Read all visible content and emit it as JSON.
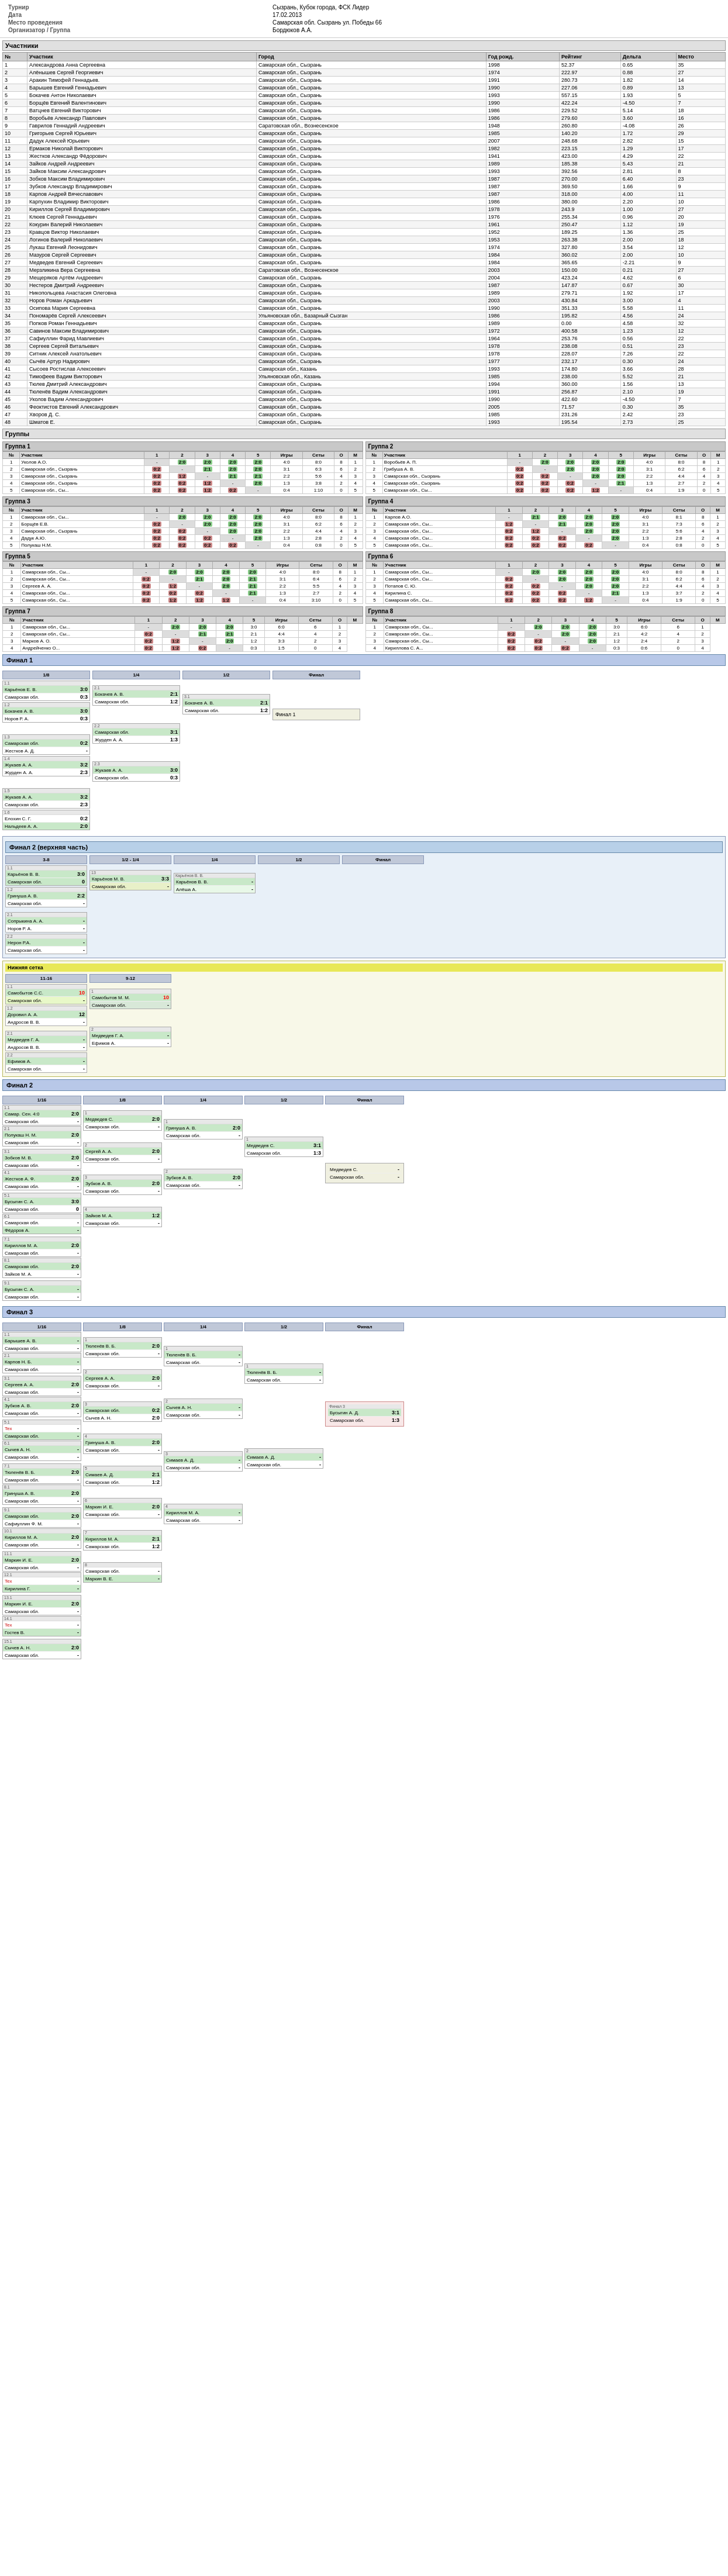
{
  "tournament": {
    "title": "Турнир",
    "city": "Сызрань, Кубок города, ФСК Лидер",
    "date": "17.02.2013",
    "venue": "Место проведения",
    "venue_val": "Самарская обл. Сызрань ул. Победы 66",
    "organizer_label": "Организатор / Группа",
    "organizer_val": "Бордюков А.А."
  },
  "participants_header": [
    "№",
    "Участник",
    "Город",
    "Год рожд.",
    "Рейтинг",
    "Дельта",
    "Место"
  ],
  "participants": [
    [
      "1",
      "Александрова Анна Сергеевна",
      "Самарская обл., Сызрань",
      "1998",
      "52.37",
      "0.65",
      "35"
    ],
    [
      "2",
      "Алёнышев Сергей Георгиевич",
      "Самарская обл., Сызрань",
      "1974",
      "222.97",
      "0.88",
      "27"
    ],
    [
      "3",
      "Аракин Тимофей Геннадьев.",
      "Самарская обл., Сызрань",
      "1991",
      "280.73",
      "1.82",
      "14"
    ],
    [
      "4",
      "Барышев Евгений Геннадьевич",
      "Самарская обл., Сызрань",
      "1990",
      "227.06",
      "0.89",
      "13"
    ],
    [
      "5",
      "Бокачев Антон Николаевич",
      "Самарская обл., Сызрань",
      "1993",
      "557.15",
      "1.93",
      "5"
    ],
    [
      "6",
      "Борщёв Евгений Валентинович",
      "Самарская обл., Сызрань",
      "1990",
      "422.24",
      "-4.50",
      "7"
    ],
    [
      "7",
      "Ватцнев Евгений Викторович",
      "Самарская обл., Сызрань",
      "1986",
      "229.52",
      "5.14",
      "18"
    ],
    [
      "8",
      "Воробьёв Александр Павлович",
      "Самарская обл., Сызрань",
      "1986",
      "279.60",
      "3.60",
      "16"
    ],
    [
      "9",
      "Гаврилов Геннадий Андреевич",
      "Саратовская обл., Вознесенское",
      "1948",
      "260.80",
      "-4.08",
      "26"
    ],
    [
      "10",
      "Григорьев Сергей Юрьевич",
      "Самарская обл., Сызрань",
      "1985",
      "140.20",
      "1.72",
      "29"
    ],
    [
      "11",
      "Дадук Алексей Юрьевич",
      "Самарская обл., Сызрань",
      "2007",
      "248.68",
      "2.82",
      "15"
    ],
    [
      "12",
      "Ермаков Николай Викторович",
      "Самарская обл., Сызрань",
      "1982",
      "223.15",
      "1.29",
      "17"
    ],
    [
      "13",
      "Жестков Александр Фёдорович",
      "Самарская обл., Сызрань",
      "1941",
      "423.00",
      "4.29",
      "22"
    ],
    [
      "14",
      "Зайков Андрей Андреевич",
      "Самарская обл., Сызрань",
      "1989",
      "185.38",
      "5.43",
      "21"
    ],
    [
      "15",
      "Зайков Максим Александрович",
      "Самарская обл., Сызрань",
      "1993",
      "392.56",
      "2.81",
      "8"
    ],
    [
      "16",
      "Зобков Максим Владимирович",
      "Самарская обл., Сызрань",
      "1987",
      "270.00",
      "6.40",
      "23"
    ],
    [
      "17",
      "Зубков Александр Владимирович",
      "Самарская обл., Сызрань",
      "1987",
      "369.50",
      "1.66",
      "9"
    ],
    [
      "18",
      "Карпов Андрей Вячеславович",
      "Самарская обл., Сызрань",
      "1987",
      "318.00",
      "4.00",
      "11"
    ],
    [
      "19",
      "Карпухин Владимир Викторович",
      "Самарская обл., Сызрань",
      "1986",
      "380.00",
      "2.20",
      "10"
    ],
    [
      "20",
      "Кириллов Сергей Владимирович",
      "Самарская обл., Сызрань",
      "1978",
      "243.9",
      "1.00",
      "27"
    ],
    [
      "21",
      "Клюев Сергей Геннадьевич",
      "Самарская обл., Сызрань",
      "1976",
      "255.34",
      "0.96",
      "20"
    ],
    [
      "22",
      "Кокурин Валерий Николаевич",
      "Самарская обл., Сызрань",
      "1961",
      "250.47",
      "1.12",
      "19"
    ],
    [
      "23",
      "Кравцов Виктор Николаевич",
      "Самарская обл., Сызрань",
      "1952",
      "189.25",
      "1.36",
      "25"
    ],
    [
      "24",
      "Логинов Валерий Николаевич",
      "Самарская обл., Сызрань",
      "1953",
      "263.38",
      "2.00",
      "18"
    ],
    [
      "25",
      "Лукаш Евгений Леонидович",
      "Самарская обл., Сызрань",
      "1974",
      "327.80",
      "3.54",
      "12"
    ],
    [
      "26",
      "Мазуров Сергей Сергеевич",
      "Самарская обл., Сызрань",
      "1984",
      "360.02",
      "2.00",
      "10"
    ],
    [
      "27",
      "Медведев Евгений Сергеевич",
      "Самарская обл., Сызрань",
      "1984",
      "365.65",
      "-2.21",
      "9"
    ],
    [
      "28",
      "Мерзликина Вера Сергеевна",
      "Саратовская обл., Вознесенское",
      "2003",
      "150.00",
      "0.21",
      "27"
    ],
    [
      "29",
      "Мещеряков Артём Андреевич",
      "Самарская обл., Сызрань",
      "2004",
      "423.24",
      "4.62",
      "6"
    ],
    [
      "30",
      "Нестеров Дмитрий Андреевич",
      "Самарская обл., Сызрань",
      "1987",
      "147.87",
      "0.67",
      "30"
    ],
    [
      "31",
      "Никопольцева Анастасия Олеговна",
      "Самарская обл., Сызрань",
      "1989",
      "279.71",
      "1.92",
      "17"
    ],
    [
      "32",
      "Норов Роман Аркадьевич",
      "Самарская обл., Сызрань",
      "2003",
      "430.84",
      "3.00",
      "4"
    ],
    [
      "33",
      "Осипова Мария Сергеевна",
      "Самарская обл., Сызрань",
      "1990",
      "351.33",
      "5.58",
      "11"
    ],
    [
      "34",
      "Пономарёв Сергей Алексеевич",
      "Ульяновская обл., Базарный Сызган",
      "1986",
      "195.82",
      "4.56",
      "24"
    ],
    [
      "35",
      "Попков Роман Геннадьевич",
      "Самарская обл., Сызрань",
      "1989",
      "0.00",
      "4.58",
      "32"
    ],
    [
      "36",
      "Савинов Максим Владимирович",
      "Самарская обл., Сызрань",
      "1972",
      "400.58",
      "1.23",
      "12"
    ],
    [
      "37",
      "Сафиуллин Фарид Мавлиевич",
      "Самарская обл., Сызрань",
      "1964",
      "253.76",
      "0.56",
      "22"
    ],
    [
      "38",
      "Сергеев Сергей Витальевич",
      "Самарская обл., Сызрань",
      "1978",
      "238.08",
      "0.51",
      "23"
    ],
    [
      "39",
      "Ситник Алексей Анатольевич",
      "Самарская обл., Сызрань",
      "1978",
      "228.07",
      "7.26",
      "22"
    ],
    [
      "40",
      "Сычёв Артур Надирович",
      "Самарская обл., Сызрань",
      "1977",
      "232.17",
      "0.30",
      "24"
    ],
    [
      "41",
      "Сысоев Ростислав Алексеевич",
      "Самарская обл., Казань",
      "1993",
      "174.80",
      "3.66",
      "28"
    ],
    [
      "42",
      "Тимофеев Вадим Викторович",
      "Ульяновская обл., Казань",
      "1985",
      "238.00",
      "5.52",
      "21"
    ],
    [
      "43",
      "Тюлев Дмитрий Александрович",
      "Самарская обл., Сызрань",
      "1994",
      "360.00",
      "1.56",
      "13"
    ],
    [
      "44",
      "Тюленёв Вадим Александрович",
      "Самарская обл., Сызрань",
      "1991",
      "256.87",
      "2.10",
      "19"
    ],
    [
      "45",
      "Уколов Вадим Александрович",
      "Самарская обл., Сызрань",
      "1990",
      "422.60",
      "-4.50",
      "7"
    ],
    [
      "46",
      "Феоктистов Евгений Александрович",
      "Самарская обл., Сызрань",
      "2005",
      "71.57",
      "0.30",
      "35"
    ],
    [
      "47",
      "Хворов Д. С.",
      "Самарская обл., Сызрань",
      "1985",
      "231.26",
      "2.42",
      "23"
    ],
    [
      "48",
      "Шматов Е.",
      "Самарская обл., Сызрань",
      "1993",
      "195.54",
      "2.73",
      "25"
    ]
  ],
  "groups": {
    "group1_title": "Группа 1",
    "group2_title": "Группа 2",
    "group3_title": "Группа 3",
    "group4_title": "Группа 4",
    "group5_title": "Группа 5",
    "group6_title": "Группа 6",
    "group7_title": "Группа 7",
    "group8_title": "Группа 8"
  },
  "playoff1_title": "Финал 1",
  "playoff2_title": "Финал 2",
  "playoff3_title": "Финал 3",
  "rounds_labels": [
    "1/8",
    "1/4",
    "1/2",
    "Финал"
  ],
  "tex_label": "Tex"
}
